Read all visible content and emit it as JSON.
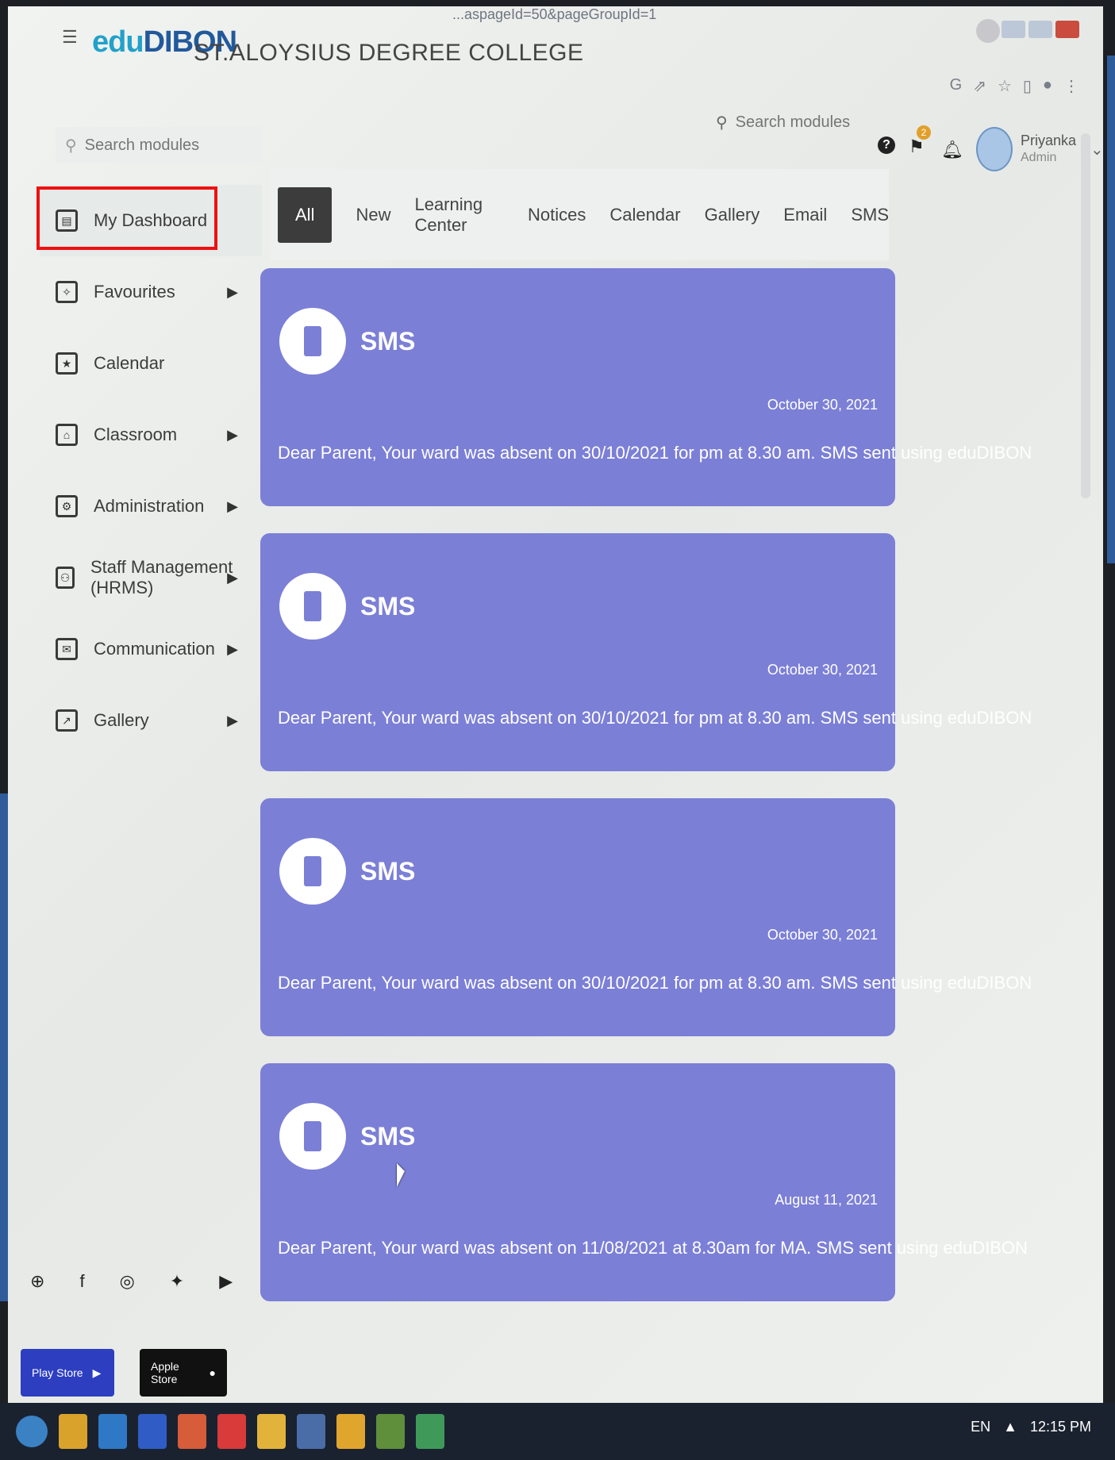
{
  "browser": {
    "url": "...aspageId=50&pageGroupId=1"
  },
  "header": {
    "logo_prefix": "edu",
    "logo_name": "DIBON",
    "college": "ST.ALOYSIUS DEGREE COLLEGE",
    "search_placeholder": "Search modules",
    "notification_count": "2",
    "user_name": "Priyanka",
    "user_role": "Admin"
  },
  "sidebar": {
    "search_placeholder": "Search modules",
    "items": [
      {
        "label": "My Dashboard",
        "icon": "dashboard-icon"
      },
      {
        "label": "Favourites",
        "icon": "favourites-icon"
      },
      {
        "label": "Calendar",
        "icon": "calendar-icon"
      },
      {
        "label": "Classroom",
        "icon": "classroom-icon"
      },
      {
        "label": "Administration",
        "icon": "administration-icon"
      },
      {
        "label": "Staff Management (HRMS)",
        "icon": "staff-icon"
      },
      {
        "label": "Communication",
        "icon": "communication-icon"
      },
      {
        "label": "Gallery",
        "icon": "gallery-icon"
      }
    ],
    "store_play": "Play Store",
    "store_apple": "Apple Store"
  },
  "tabs": [
    "All",
    "New",
    "Learning Center",
    "Notices",
    "Calendar",
    "Gallery",
    "Email",
    "SMS"
  ],
  "feed": [
    {
      "type": "SMS",
      "date": "October 30, 2021",
      "message": "Dear Parent, Your ward was absent on 30/10/2021 for pm at 8.30 am. SMS sent using eduDIBON"
    },
    {
      "type": "SMS",
      "date": "October 30, 2021",
      "message": "Dear Parent, Your ward was absent on 30/10/2021 for pm at 8.30 am. SMS sent using eduDIBON"
    },
    {
      "type": "SMS",
      "date": "October 30, 2021",
      "message": "Dear Parent, Your ward was absent on 30/10/2021 for pm at 8.30 am. SMS sent using eduDIBON"
    },
    {
      "type": "SMS",
      "date": "August 11, 2021",
      "message": "Dear Parent, Your ward was absent on 11/08/2021 at 8.30am for MA. SMS sent using eduDIBON"
    }
  ],
  "taskbar": {
    "time": "12:15 PM"
  },
  "colors": {
    "card": "#7b7fd6",
    "highlight": "#e11111",
    "logo": "#22599b"
  }
}
